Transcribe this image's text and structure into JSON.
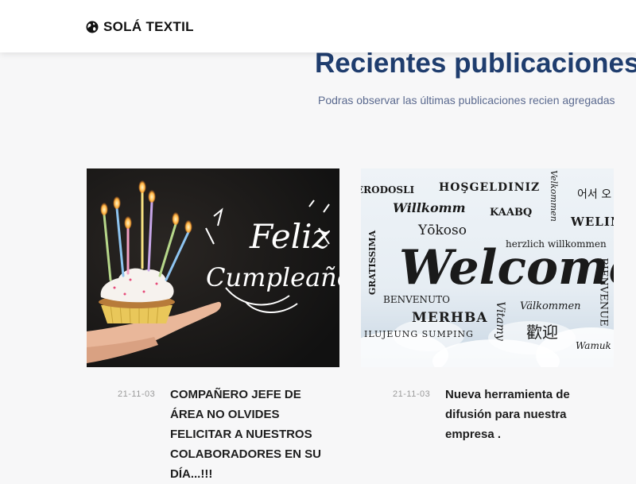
{
  "navbar": {
    "brand": "SOLÁ TEXTIL",
    "brand_icon": "globe-icon"
  },
  "section": {
    "title": "Recientes publicaciones",
    "subtitle": "Podras observar las últimas publicaciones recien agregadas"
  },
  "posts": [
    {
      "date": "21-11-03",
      "title_lines": [
        "COMPAÑERO JEFE DE",
        "ÁREA NO OLVIDES",
        "FELICITAR A NUESTROS",
        "COLABORADORES EN SU",
        "DÍA...!!!"
      ],
      "image": {
        "type": "birthday",
        "greeting_line1": "Feliz",
        "greeting_line2": "Cumpleaños"
      }
    },
    {
      "date": "21-11-03",
      "title_lines": [
        "Nueva herramienta de",
        "difusión para nuestra",
        "empresa ."
      ],
      "image": {
        "type": "welcome",
        "main_word": "Welcome",
        "words": [
          "HOŞGELDINIZ",
          "Willkomm",
          "KAABQ",
          "Yōkoso",
          "herzlich willkommen",
          "BIENVENUE",
          "BENVENUTO",
          "MERHBA",
          "Välkommen",
          "歡迎",
          "ILUJEUNG SUMPING",
          "Wamuk",
          "어서 오",
          "WELIN",
          "Vitamy",
          "GRATISSIMA",
          "Velkommen",
          "ERODOSLI"
        ]
      }
    }
  ]
}
